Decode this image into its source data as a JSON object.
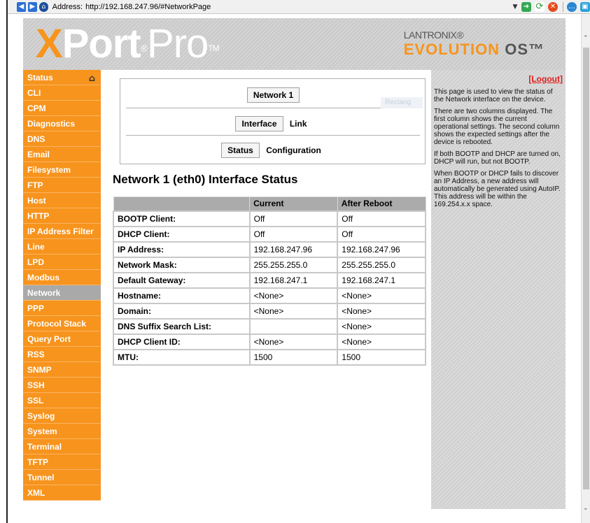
{
  "browser": {
    "address_label": "Address:",
    "url": "http://192.168.247.96/#NetworkPage",
    "icons": [
      "back-icon",
      "forward-icon",
      "home-icon",
      "go-icon",
      "refresh-icon",
      "stop-icon",
      "chat-icon",
      "image-icon"
    ]
  },
  "banner": {
    "logo_x": "X",
    "logo_port": "Port",
    "logo_reg": "®",
    "logo_pro": "Pro",
    "logo_tm": "TM",
    "brand_company": "LANTRONIX®",
    "brand_evo": "EVOLUTION",
    "brand_os": "OS™",
    "accent_color": "#f7941d"
  },
  "sidebar": {
    "items": [
      {
        "label": "Status"
      },
      {
        "label": "CLI"
      },
      {
        "label": "CPM"
      },
      {
        "label": "Diagnostics"
      },
      {
        "label": "DNS"
      },
      {
        "label": "Email"
      },
      {
        "label": "Filesystem"
      },
      {
        "label": "FTP"
      },
      {
        "label": "Host"
      },
      {
        "label": "HTTP"
      },
      {
        "label": "IP Address Filter"
      },
      {
        "label": "Line"
      },
      {
        "label": "LPD"
      },
      {
        "label": "Modbus"
      },
      {
        "label": "Network"
      },
      {
        "label": "PPP"
      },
      {
        "label": "Protocol Stack"
      },
      {
        "label": "Query Port"
      },
      {
        "label": "RSS"
      },
      {
        "label": "SNMP"
      },
      {
        "label": "SSH"
      },
      {
        "label": "SSL"
      },
      {
        "label": "Syslog"
      },
      {
        "label": "System"
      },
      {
        "label": "Terminal"
      },
      {
        "label": "TFTP"
      },
      {
        "label": "Tunnel"
      },
      {
        "label": "XML"
      }
    ],
    "active": "Network"
  },
  "nav": {
    "network": "Network 1",
    "interface": "Interface",
    "link": "Link",
    "status": "Status",
    "configuration": "Configuration",
    "ghost_text": "Rectang"
  },
  "main": {
    "title": "Network 1 (eth0) Interface Status",
    "columns": [
      "",
      "Current",
      "After Reboot"
    ],
    "rows": [
      {
        "label": "BOOTP Client:",
        "current": "Off",
        "after": "Off"
      },
      {
        "label": "DHCP Client:",
        "current": "Off",
        "after": "Off"
      },
      {
        "label": "IP Address:",
        "current": "192.168.247.96",
        "after": "192.168.247.96"
      },
      {
        "label": "Network Mask:",
        "current": "255.255.255.0",
        "after": "255.255.255.0"
      },
      {
        "label": "Default Gateway:",
        "current": "192.168.247.1",
        "after": "192.168.247.1"
      },
      {
        "label": "Hostname:",
        "current": "<None>",
        "after": "<None>"
      },
      {
        "label": "Domain:",
        "current": "<None>",
        "after": "<None>"
      },
      {
        "label": "DNS Suffix Search List:",
        "current": "",
        "after": "<None>"
      },
      {
        "label": "DHCP Client ID:",
        "current": "<None>",
        "after": "<None>"
      },
      {
        "label": "MTU:",
        "current": "1500",
        "after": "1500"
      }
    ]
  },
  "help": {
    "logout": "[Logout]",
    "paragraphs": [
      "This page is used to view the status of the Network interface on the device.",
      "There are two columns displayed. The first column shows the current operational settings. The second column shows the expected settings after the device is rebooted.",
      "If both BOOTP and DHCP are turned on, DHCP will run, but not BOOTP.",
      "When BOOTP or DHCP fails to discover an IP Address, a new address will automatically be generated using AutoIP. This address will be within the 169.254.x.x space."
    ]
  }
}
